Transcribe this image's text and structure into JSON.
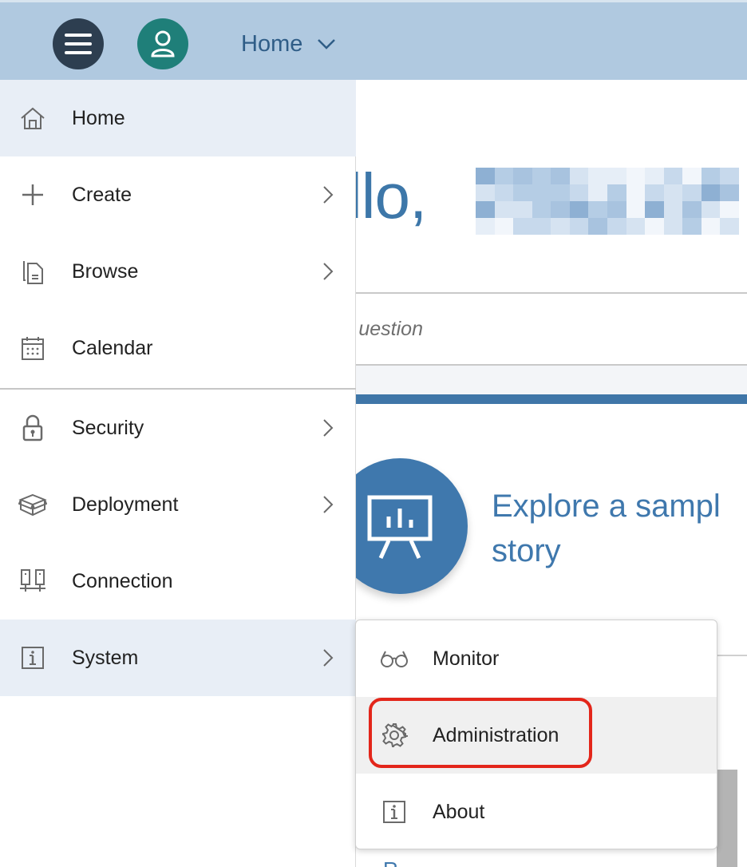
{
  "shell": {
    "title": "Home",
    "icons": {
      "menu": "hamburger-icon",
      "avatar": "user-icon",
      "dropdown": "chevron-down-icon"
    },
    "colors": {
      "bar": "#b0c9e0",
      "menu_button": "#2d3e50",
      "avatar": "#1f7f79",
      "title": "#2f5d87"
    }
  },
  "main": {
    "greeting": "llo,",
    "question_placeholder": "uestion",
    "story_title_line1": "Explore a sampl",
    "story_title_line2": "story",
    "story_icon": "presentation-chart-icon",
    "bottom_peek": "R",
    "colors": {
      "accent": "#3f76a8",
      "text": "#3d77a9"
    }
  },
  "sidebar": {
    "items": [
      {
        "label": "Home",
        "icon": "home-icon",
        "has_submenu": false
      },
      {
        "label": "Create",
        "icon": "plus-icon",
        "has_submenu": true
      },
      {
        "label": "Browse",
        "icon": "document-icon",
        "has_submenu": true
      },
      {
        "label": "Calendar",
        "icon": "calendar-icon",
        "has_submenu": false
      },
      {
        "label": "Security",
        "icon": "lock-icon",
        "has_submenu": true
      },
      {
        "label": "Deployment",
        "icon": "package-icon",
        "has_submenu": true
      },
      {
        "label": "Connection",
        "icon": "connection-icon",
        "has_submenu": false
      },
      {
        "label": "System",
        "icon": "info-icon",
        "has_submenu": true
      }
    ],
    "selected": "Home",
    "expanded": "System"
  },
  "submenu": {
    "items": [
      {
        "label": "Monitor",
        "icon": "glasses-icon"
      },
      {
        "label": "Administration",
        "icon": "gear-icon"
      },
      {
        "label": "About",
        "icon": "info-icon"
      }
    ],
    "hovered": "Administration",
    "highlight_color": "#e3261a"
  }
}
